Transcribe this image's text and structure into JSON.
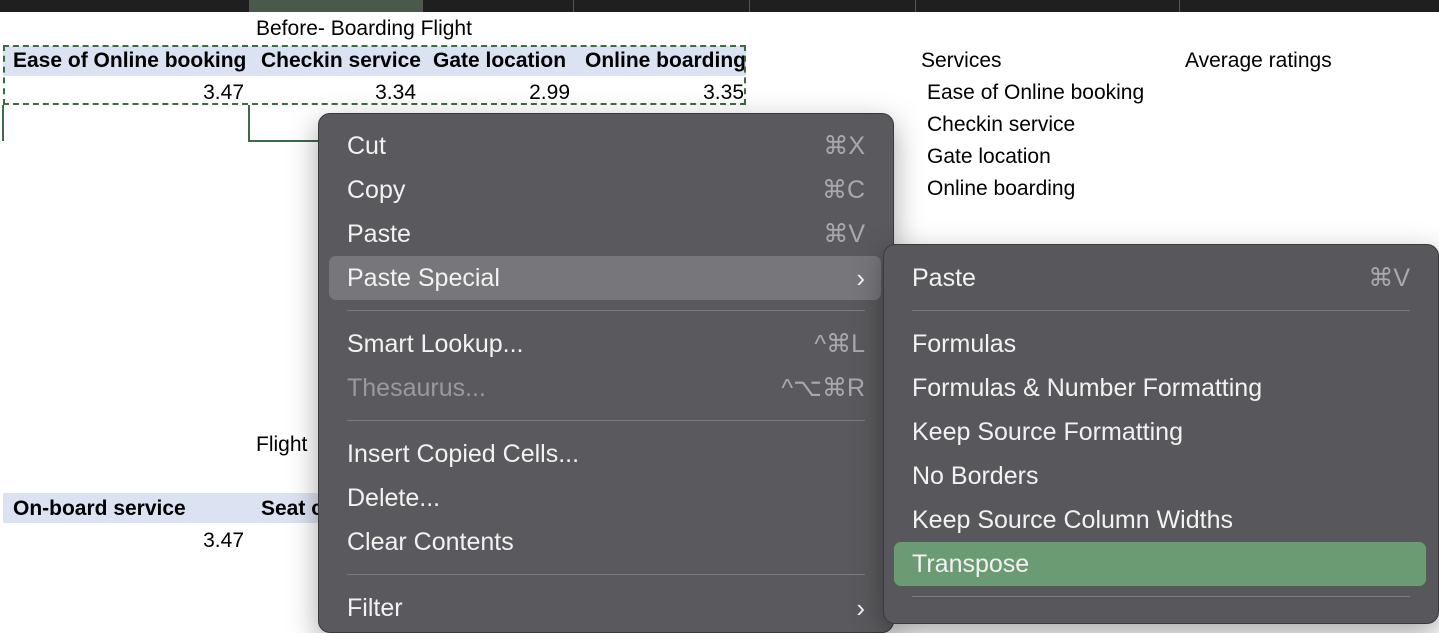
{
  "sheet": {
    "title_before": "Before- Boarding Flight",
    "title_flight": "Flight",
    "headers_before": [
      "Ease of Online booking",
      "Checkin service",
      "Gate location",
      "Online boarding"
    ],
    "values_before": [
      "3.47",
      "3.34",
      "2.99",
      "3.35"
    ],
    "headers_flight": [
      "On-board service",
      "Seat c"
    ],
    "values_flight": [
      "3.47"
    ],
    "services_header": "Services",
    "ratings_header": "Average ratings",
    "services": [
      "Ease of Online booking",
      "Checkin service",
      "Gate location",
      "Online boarding"
    ]
  },
  "context_menu": {
    "items": [
      {
        "label": "Cut",
        "shortcut": "⌘X"
      },
      {
        "label": "Copy",
        "shortcut": "⌘C"
      },
      {
        "label": "Paste",
        "shortcut": "⌘V"
      },
      {
        "label": "Paste Special",
        "shortcut": "›"
      },
      {
        "label": "Smart Lookup...",
        "shortcut": "^⌘L"
      },
      {
        "label": "Thesaurus...",
        "shortcut": "^⌥⌘R"
      },
      {
        "label": "Insert Copied Cells...",
        "shortcut": ""
      },
      {
        "label": "Delete...",
        "shortcut": ""
      },
      {
        "label": "Clear Contents",
        "shortcut": ""
      },
      {
        "label": "Filter",
        "shortcut": "›"
      }
    ]
  },
  "paste_special_menu": {
    "items": [
      {
        "label": "Paste",
        "shortcut": "⌘V"
      },
      {
        "label": "Formulas"
      },
      {
        "label": "Formulas & Number Formatting"
      },
      {
        "label": "Keep Source Formatting"
      },
      {
        "label": "No Borders"
      },
      {
        "label": "Keep Source Column Widths"
      },
      {
        "label": "Transpose"
      }
    ]
  },
  "colors": {
    "menu_bg": "#5a5a5e",
    "highlight": "#77777b",
    "transpose_highlight": "#6b9b73",
    "marquee": "#3d6b45",
    "header_band": "#dbe3f3"
  }
}
